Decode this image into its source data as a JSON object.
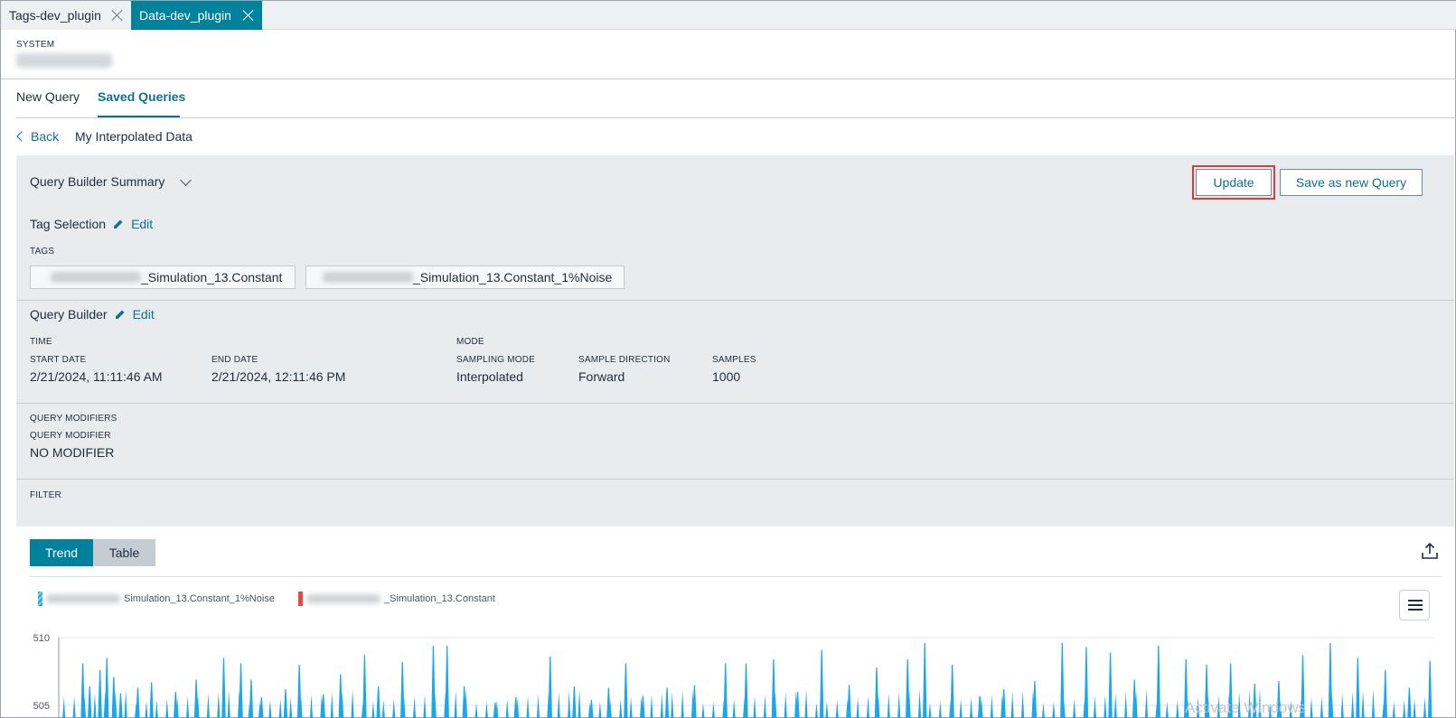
{
  "tabs": [
    {
      "label": "Tags-dev_plugin",
      "active": false
    },
    {
      "label": "Data-dev_plugin",
      "active": true
    }
  ],
  "system": {
    "label": "SYSTEM"
  },
  "nav": {
    "new_query": "New Query",
    "saved_queries": "Saved Queries"
  },
  "breadcrumb": {
    "back": "Back",
    "query_name": "My Interpolated Data"
  },
  "summary": {
    "title": "Query Builder Summary",
    "update": "Update",
    "save_new": "Save as new Query",
    "tag_selection": {
      "title": "Tag Selection",
      "edit": "Edit"
    },
    "tags_label": "TAGS",
    "tags": [
      "_Simulation_13.Constant",
      "_Simulation_13.Constant_1%Noise"
    ],
    "query_builder": {
      "title": "Query Builder",
      "edit": "Edit"
    },
    "time": {
      "label": "TIME",
      "start_label": "START DATE",
      "start_value": "2/21/2024, 11:11:46 AM",
      "end_label": "END DATE",
      "end_value": "2/21/2024, 12:11:46 PM"
    },
    "mode": {
      "label": "MODE",
      "sampling_label": "SAMPLING MODE",
      "sampling_value": "Interpolated",
      "direction_label": "SAMPLE DIRECTION",
      "direction_value": "Forward",
      "samples_label": "SAMPLES",
      "samples_value": "1000"
    },
    "modifiers": {
      "label": "QUERY MODIFIERS",
      "modifier_label": "QUERY MODIFIER",
      "modifier_value": "NO MODIFIER"
    },
    "filter_label": "FILTER"
  },
  "view_toggle": {
    "trend": "Trend",
    "table": "Table"
  },
  "legend": [
    {
      "name": "Simulation_13.Constant_1%Noise",
      "color": "#1aa7ec"
    },
    {
      "name": "_Simulation_13.Constant",
      "color": "#e8493f"
    }
  ],
  "colors": {
    "accent": "#00819c",
    "link": "#11718a",
    "highlight": "#e0393a"
  },
  "watermark": "Activate Windows",
  "chart_data": {
    "type": "line",
    "ytick_labels": [
      "510",
      "505"
    ],
    "series": [
      {
        "name": "Simulation_13.Constant_1%Noise",
        "color": "#1aa7ec"
      },
      {
        "name": "_Simulation_13.Constant",
        "color": "#e8493f"
      }
    ],
    "noise_peaks": [
      {
        "x": 7,
        "y": 508.1
      },
      {
        "x": 9,
        "y": 506.4
      },
      {
        "x": 12,
        "y": 507.6
      },
      {
        "x": 14,
        "y": 508.5
      },
      {
        "x": 16,
        "y": 507.1
      },
      {
        "x": 18,
        "y": 505.9
      },
      {
        "x": 23,
        "y": 506.3
      },
      {
        "x": 27,
        "y": 506.7
      },
      {
        "x": 34,
        "y": 506.0
      },
      {
        "x": 40,
        "y": 506.9
      },
      {
        "x": 48,
        "y": 508.5
      },
      {
        "x": 53,
        "y": 508.1
      },
      {
        "x": 56,
        "y": 506.9
      },
      {
        "x": 59,
        "y": 505.6
      },
      {
        "x": 66,
        "y": 506.2
      },
      {
        "x": 70,
        "y": 508.0
      },
      {
        "x": 77,
        "y": 505.8
      },
      {
        "x": 82,
        "y": 507.3
      },
      {
        "x": 89,
        "y": 508.7
      },
      {
        "x": 93,
        "y": 506.4
      },
      {
        "x": 100,
        "y": 508.2
      },
      {
        "x": 109,
        "y": 509.4
      },
      {
        "x": 113,
        "y": 509.4
      },
      {
        "x": 118,
        "y": 506.4
      },
      {
        "x": 127,
        "y": 505.2
      },
      {
        "x": 133,
        "y": 505.6
      },
      {
        "x": 143,
        "y": 508.6
      },
      {
        "x": 150,
        "y": 506.4
      },
      {
        "x": 155,
        "y": 505.4
      },
      {
        "x": 160,
        "y": 506.3
      },
      {
        "x": 165,
        "y": 508.1
      },
      {
        "x": 170,
        "y": 505.7
      },
      {
        "x": 177,
        "y": 506.3
      },
      {
        "x": 185,
        "y": 506.5
      },
      {
        "x": 194,
        "y": 508.1
      },
      {
        "x": 200,
        "y": 508.1
      },
      {
        "x": 208,
        "y": 508.4
      },
      {
        "x": 215,
        "y": 506.0
      },
      {
        "x": 222,
        "y": 509.1
      },
      {
        "x": 230,
        "y": 506.5
      },
      {
        "x": 238,
        "y": 507.8
      },
      {
        "x": 247,
        "y": 508.4
      },
      {
        "x": 252,
        "y": 509.6
      },
      {
        "x": 260,
        "y": 508.0
      },
      {
        "x": 268,
        "y": 505.7
      },
      {
        "x": 275,
        "y": 506.2
      },
      {
        "x": 284,
        "y": 506.8
      },
      {
        "x": 292,
        "y": 509.6
      },
      {
        "x": 299,
        "y": 509.3
      },
      {
        "x": 306,
        "y": 508.9
      },
      {
        "x": 313,
        "y": 506.9
      },
      {
        "x": 320,
        "y": 509.4
      },
      {
        "x": 328,
        "y": 508.4
      },
      {
        "x": 334,
        "y": 508.0
      },
      {
        "x": 341,
        "y": 508.1
      },
      {
        "x": 348,
        "y": 506.6
      },
      {
        "x": 355,
        "y": 506.8
      },
      {
        "x": 362,
        "y": 508.7
      },
      {
        "x": 370,
        "y": 509.6
      },
      {
        "x": 378,
        "y": 508.5
      },
      {
        "x": 386,
        "y": 507.6
      },
      {
        "x": 393,
        "y": 506.3
      },
      {
        "x": 399,
        "y": 508.3
      }
    ],
    "baseline": 504.2,
    "ylim": [
      504.2,
      510
    ]
  }
}
